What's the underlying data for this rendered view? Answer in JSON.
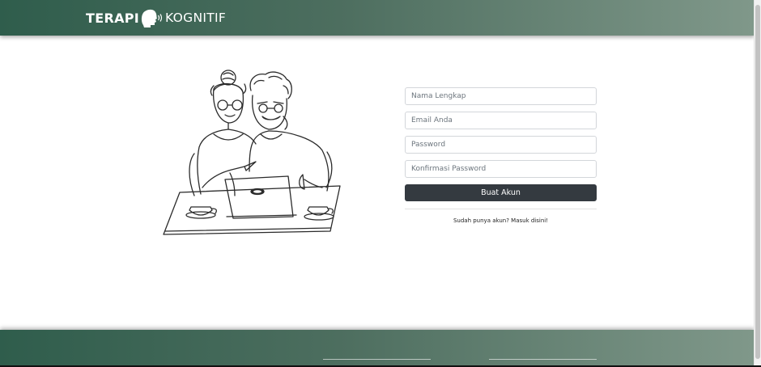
{
  "brand": {
    "part1": "TERAPI",
    "part2": "KOGNITIF",
    "logo_icon": "head-speaking-icon"
  },
  "illustration": {
    "icon": "couple-with-laptop-illustration"
  },
  "form": {
    "fullname_placeholder": "Nama Lengkap",
    "email_placeholder": "Email Anda",
    "password_placeholder": "Password",
    "confirm_password_placeholder": "Konfirmasi Password",
    "submit_label": "Buat Akun",
    "login_text": "Sudah punya akun? Masuk disini!"
  },
  "colors": {
    "header_start": "#2f5d4c",
    "header_end": "#80988a",
    "button": "#343a40"
  }
}
